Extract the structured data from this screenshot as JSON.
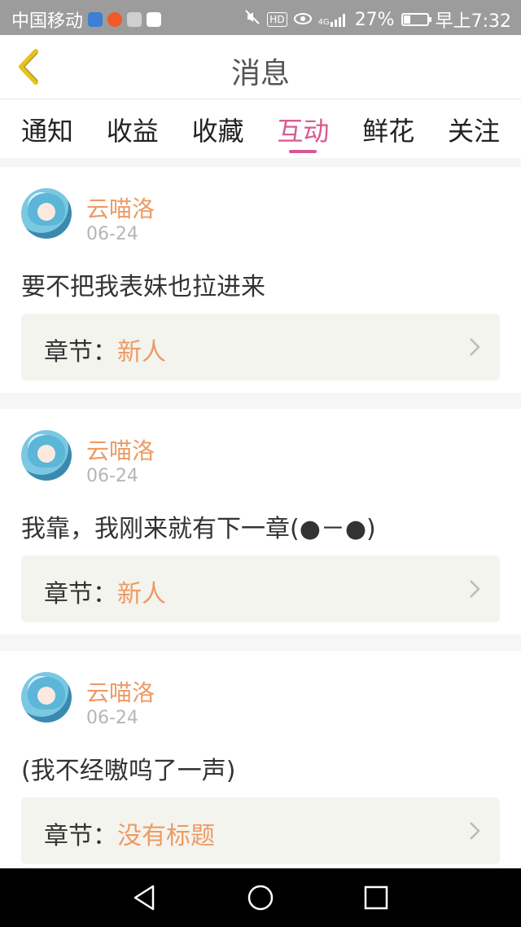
{
  "status_bar": {
    "carrier": "中国移动",
    "hd": "HD",
    "network": "4G",
    "battery_percent": "27%",
    "battery_level": 0.27,
    "time": "早上7:32"
  },
  "header": {
    "title": "消息",
    "back_icon": "chevron-left-icon"
  },
  "tabs": [
    {
      "label": "通知"
    },
    {
      "label": "收益"
    },
    {
      "label": "收藏"
    },
    {
      "label": "互动",
      "active": true
    },
    {
      "label": "鲜花"
    },
    {
      "label": "关注"
    }
  ],
  "messages": [
    {
      "user": "云喵洛",
      "date": "06-24",
      "content": "要不把我表妹也拉进来",
      "chapter_label": "章节：",
      "chapter_value": "新人"
    },
    {
      "user": "云喵洛",
      "date": "06-24",
      "content": "我靠，我刚来就有下一章(●－●)",
      "chapter_label": "章节：",
      "chapter_value": "新人"
    },
    {
      "user": "云喵洛",
      "date": "06-24",
      "content": "(我不经嗷呜了一声)",
      "chapter_label": "章节：",
      "chapter_value": "没有标题"
    }
  ],
  "colors": {
    "accent": "#d85a91",
    "username": "#ee9a64",
    "back_icon": "#e8c21a"
  },
  "nav_bar": {
    "icons": [
      "back-triangle-icon",
      "home-circle-icon",
      "recents-square-icon"
    ]
  }
}
